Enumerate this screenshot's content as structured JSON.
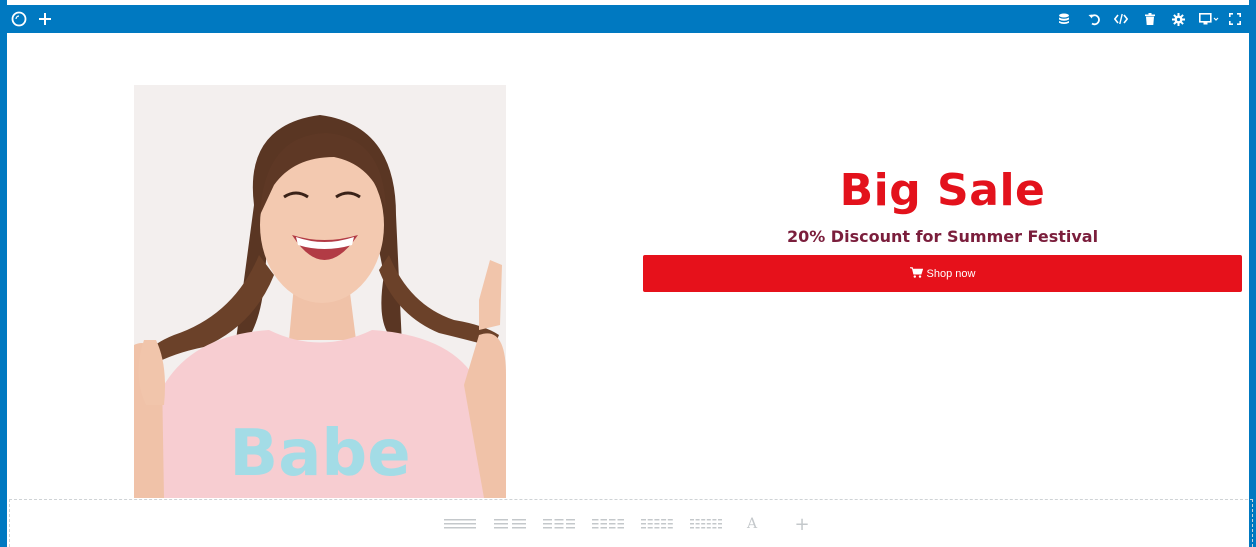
{
  "toolbar": {
    "left_icons": [
      "logo-ring-icon",
      "add-icon"
    ],
    "right_icons": [
      "database-icon",
      "undo-icon",
      "code-icon",
      "trash-icon",
      "gear-icon",
      "device-preview-icon",
      "fullscreen-icon"
    ]
  },
  "hero": {
    "image_alt": "Smiling girl with braids in pink Babe t-shirt",
    "title": "Big Sale",
    "subtitle": "20% Discount for Summer Festival",
    "button_label": "Shop now",
    "button_icon": "cart-icon"
  },
  "colors": {
    "toolbar_bg": "#0079c1",
    "accent_red": "#e6111b",
    "subtitle_color": "#7b1e3c"
  },
  "dropzone": {
    "text_tool_label": "A",
    "add_label": "+",
    "layout_icons": [
      "layout-1col-icon",
      "layout-2col-icon",
      "layout-3col-icon",
      "layout-4col-icon",
      "layout-5col-icon",
      "layout-6col-icon"
    ]
  }
}
